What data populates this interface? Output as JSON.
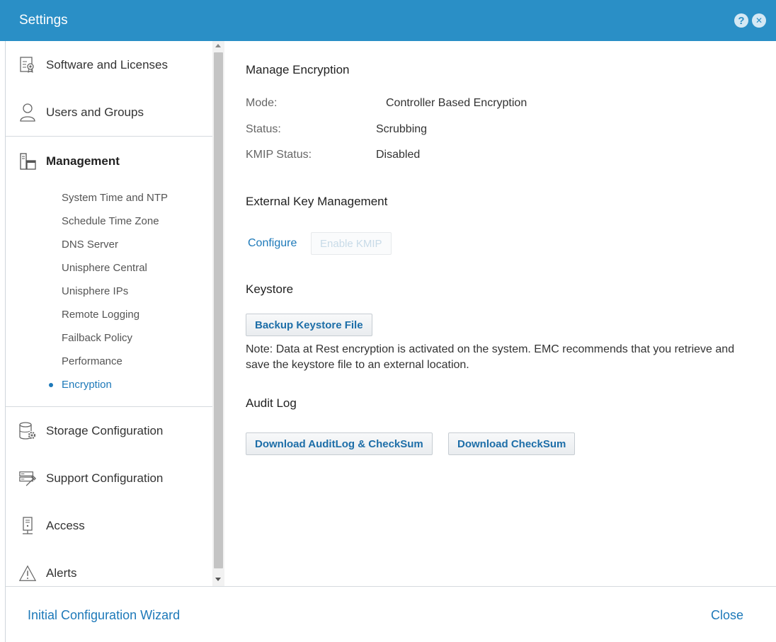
{
  "window": {
    "title": "Settings"
  },
  "titlebar": {
    "help_glyph": "?",
    "close_glyph": "✕"
  },
  "sidebar": {
    "items": [
      {
        "label": "Software and Licenses",
        "icon": "license-icon"
      },
      {
        "label": "Users and Groups",
        "icon": "user-icon"
      },
      {
        "label": "Management",
        "icon": "management-icon",
        "expanded": true
      },
      {
        "label": "Storage Configuration",
        "icon": "storage-gear-icon"
      },
      {
        "label": "Support Configuration",
        "icon": "support-tools-icon"
      },
      {
        "label": "Access",
        "icon": "access-icon"
      },
      {
        "label": "Alerts",
        "icon": "alert-icon"
      }
    ],
    "management_subitems": [
      "System Time and NTP",
      "Schedule Time Zone",
      "DNS Server",
      "Unisphere Central",
      "Unisphere IPs",
      "Remote Logging",
      "Failback Policy",
      "Performance",
      "Encryption"
    ],
    "active_subitem": "Encryption"
  },
  "content": {
    "manage_encryption": {
      "heading": "Manage Encryption",
      "mode_label": "Mode:",
      "mode_value": "Controller Based Encryption",
      "status_label": "Status:",
      "status_value": "Scrubbing",
      "kmip_label": "KMIP Status:",
      "kmip_value": "Disabled"
    },
    "external_key": {
      "heading": "External Key Management",
      "configure_link": "Configure",
      "enable_kmip_button": "Enable KMIP"
    },
    "keystore": {
      "heading": "Keystore",
      "backup_button": "Backup Keystore File",
      "note": "Note: Data at Rest encryption is activated on the system. EMC recommends that you retrieve and save the keystore file to an external location."
    },
    "audit_log": {
      "heading": "Audit Log",
      "download_audit_button": "Download AuditLog & CheckSum",
      "download_checksum_button": "Download CheckSum"
    }
  },
  "footer": {
    "wizard_link": "Initial Configuration Wizard",
    "close_link": "Close"
  },
  "colors": {
    "titlebar": "#2a8fc6",
    "accent": "#1d79b9"
  }
}
